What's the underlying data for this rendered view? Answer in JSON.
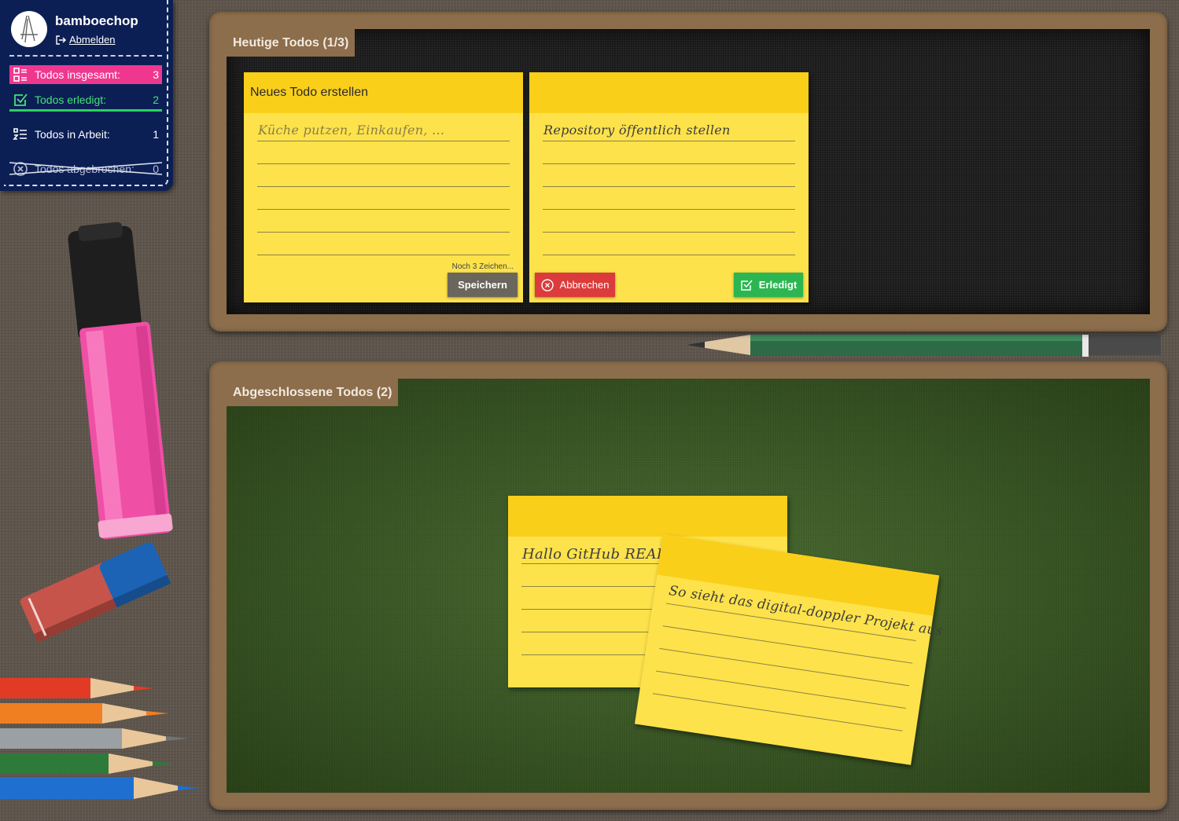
{
  "user": {
    "name": "bamboechop",
    "logout_label": "Abmelden"
  },
  "stats": {
    "total": {
      "label": "Todos insgesamt:",
      "value": "3",
      "icon": "list-icon"
    },
    "done": {
      "label": "Todos erledigt:",
      "value": "2",
      "icon": "checkbox-icon"
    },
    "in_progress": {
      "label": "Todos in Arbeit:",
      "value": "1",
      "icon": "numbered-list-icon"
    },
    "aborted": {
      "label": "Todos abgebrochen:",
      "value": "0",
      "icon": "cancel-circle-icon"
    }
  },
  "today_board": {
    "title": "Heutige Todos (1/3)",
    "new_note": {
      "header": "Neues Todo erstellen",
      "placeholder": "Küche putzen, Einkaufen, ...",
      "char_hint": "Noch 3 Zeichen...",
      "save_label": "Speichern"
    },
    "active_note": {
      "text": "Repository öffentlich stellen",
      "cancel_label": "Abbrechen",
      "done_label": "Erledigt"
    }
  },
  "done_board": {
    "title": "Abgeschlossene Todos (2)",
    "notes": [
      {
        "text": "Hallo GitHub README!"
      },
      {
        "text": "So sieht das digital-doppler Projekt aus"
      }
    ]
  },
  "colors": {
    "panel": "#0c1f55",
    "accent_pink": "#f0378f",
    "accent_green": "#2bd05f",
    "note_yellow": "#fde24b",
    "note_header": "#facf1a",
    "cancel_red": "#dc3b3b",
    "done_green": "#2bb652"
  }
}
